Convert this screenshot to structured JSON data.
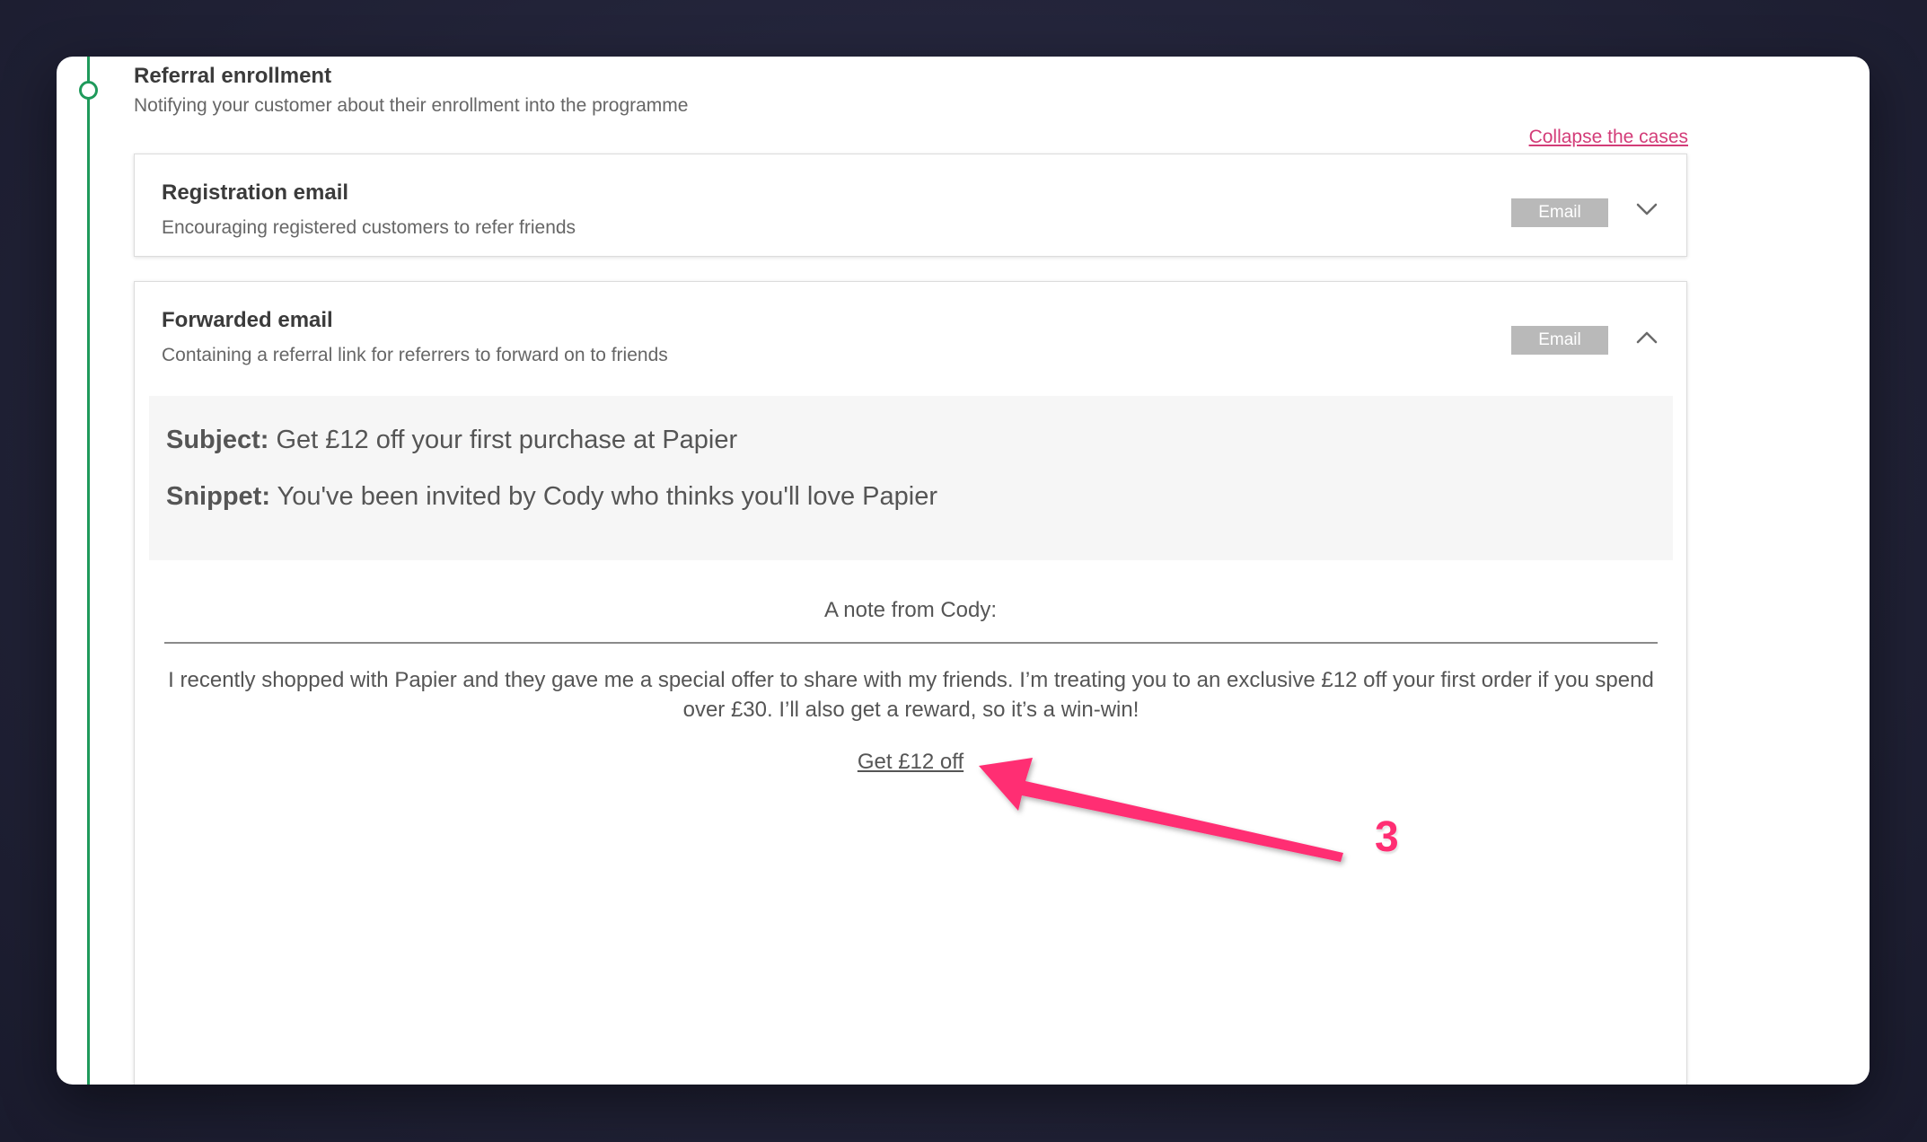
{
  "section": {
    "title": "Referral enrollment",
    "subtitle": "Notifying your customer about their enrollment into the programme",
    "collapse_label": "Collapse the cases"
  },
  "cards": [
    {
      "title": "Registration email",
      "description": "Encouraging registered customers to refer friends",
      "badge": "Email",
      "expanded": false
    },
    {
      "title": "Forwarded email",
      "description": "Containing a referral link for referrers to forward on to friends",
      "badge": "Email",
      "expanded": true
    }
  ],
  "preview": {
    "subject_label": "Subject:",
    "subject": "Get £12 off your first purchase at Papier",
    "snippet_label": "Snippet:",
    "snippet": "You've been invited by Cody who thinks you'll love Papier"
  },
  "note": {
    "header": "A note from Cody:",
    "body": "I recently shopped with Papier and they gave me a special offer to share with my friends. I’m treating you to an exclusive £12 off your first order if you spend over £30. I’ll also get a reward, so it’s a win-win!",
    "cta": "Get £12 off"
  },
  "annotation": {
    "step_number": "3",
    "color": "#ff2e73"
  },
  "colors": {
    "timeline": "#1f9a5b",
    "link": "#d33c78",
    "badge": "#b9b9b9"
  }
}
